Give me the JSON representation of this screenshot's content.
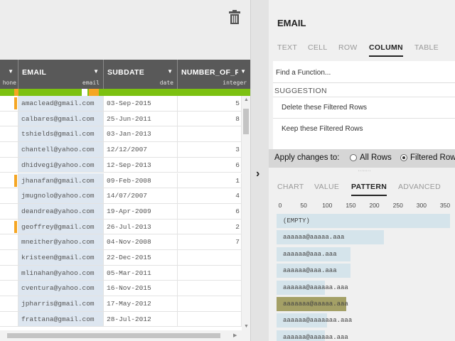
{
  "columns": [
    {
      "name": "EMAIL",
      "type": "email"
    },
    {
      "name": "SUBDATE",
      "type": "date"
    },
    {
      "name": "NUMBER_OF_RI",
      "type": "integer"
    }
  ],
  "partial_column": {
    "type": "hone"
  },
  "rows": [
    {
      "email": "amaclead@gmail.com",
      "date": "03-Sep-2015",
      "num": "5",
      "flag": true
    },
    {
      "email": "calbares@gmail.com",
      "date": "25-Jun-2011",
      "num": "8",
      "flag": false
    },
    {
      "email": "tshields@gmail.com",
      "date": "03-Jan-2013",
      "num": "",
      "flag": false
    },
    {
      "email": "chantell@yahoo.com",
      "date": "12/12/2007",
      "num": "3",
      "flag": false
    },
    {
      "email": "dhidvegi@yahoo.com",
      "date": "12-Sep-2013",
      "num": "6",
      "flag": false
    },
    {
      "email": "jhanafan@gmail.com",
      "date": "09-Feb-2008",
      "num": "1",
      "flag": true
    },
    {
      "email": "jmugnolo@yahoo.com",
      "date": "14/07/2007",
      "num": "4",
      "flag": false
    },
    {
      "email": "deandrea@yahoo.com",
      "date": "19-Apr-2009",
      "num": "6",
      "flag": false
    },
    {
      "email": "geoffrey@gmail.com",
      "date": "26-Jul-2013",
      "num": "2",
      "flag": true
    },
    {
      "email": "mneither@yahoo.com",
      "date": "04-Nov-2008",
      "num": "7",
      "flag": false
    },
    {
      "email": "kristeen@gmail.com",
      "date": "22-Dec-2015",
      "num": "",
      "flag": false
    },
    {
      "email": "mlinahan@yahoo.com",
      "date": "05-Mar-2011",
      "num": "",
      "flag": false
    },
    {
      "email": "cventura@yahoo.com",
      "date": "16-Nov-2015",
      "num": "",
      "flag": false
    },
    {
      "email": "jpharris@gmail.com",
      "date": "17-May-2012",
      "num": "",
      "flag": false
    },
    {
      "email": "frattana@gmail.com",
      "date": "28-Jul-2012",
      "num": "",
      "flag": false
    }
  ],
  "panel": {
    "title": "EMAIL",
    "scope_tabs": [
      "TEXT",
      "CELL",
      "ROW",
      "COLUMN",
      "TABLE"
    ],
    "active_scope": "COLUMN",
    "find_placeholder": "Find a Function...",
    "suggestion_header": "SUGGESTION",
    "suggestions": [
      "Delete these Filtered Rows",
      "Keep these Filtered Rows"
    ],
    "apply_label": "Apply changes to:",
    "apply_options": [
      "All Rows",
      "Filtered Row"
    ],
    "apply_selected": "Filtered Row",
    "view_tabs": [
      "CHART",
      "VALUE",
      "PATTERN",
      "ADVANCED"
    ],
    "active_view": "PATTERN"
  },
  "chart_data": {
    "type": "bar",
    "orientation": "horizontal",
    "x_ticks": [
      0,
      50,
      100,
      150,
      200,
      250,
      300,
      350
    ],
    "xlim": [
      0,
      350
    ],
    "categories": [
      "(EMPTY)",
      "aaaaaa@aaaaa.aaa",
      "aaaaaa@aaa.aaa",
      "aaaaaa@aaa.aaa",
      "aaaaaa@aaaaaa.aaa",
      "aaaaaaa@aaaaa.aaa",
      "aaaaaa@aaaaaaa.aaa",
      "aaaaaa@aaaaaa.aaa"
    ],
    "values": [
      360,
      220,
      150,
      150,
      95,
      140,
      100,
      95
    ],
    "highlighted": [
      5
    ]
  }
}
